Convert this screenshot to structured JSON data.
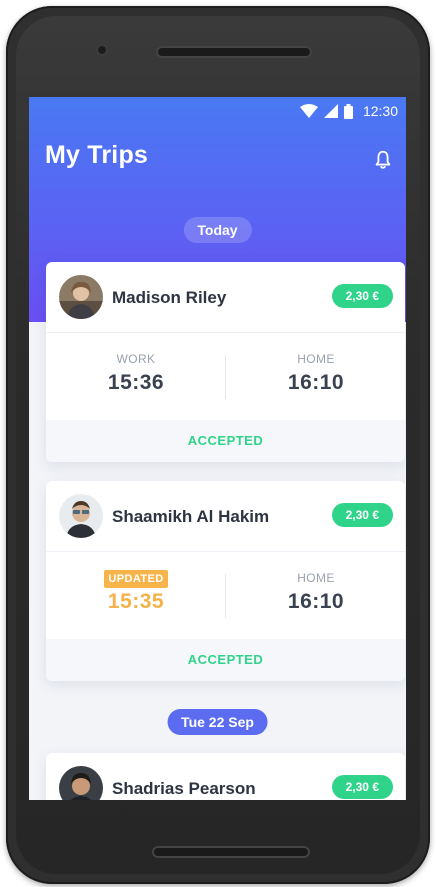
{
  "status_bar": {
    "time": "12:30"
  },
  "header": {
    "title": "My Trips"
  },
  "sections": [
    {
      "label": "Today"
    },
    {
      "label": "Tue 22 Sep"
    }
  ],
  "trips": [
    {
      "name": "Madison Riley",
      "price": "2,30 €",
      "from_label": "WORK",
      "from_time": "15:36",
      "to_label": "HOME",
      "to_time": "16:10",
      "status": "ACCEPTED"
    },
    {
      "name": "Shaamikh Al Hakim",
      "price": "2,30 €",
      "from_label": "UPDATED",
      "from_time": "15:35",
      "to_label": "HOME",
      "to_time": "16:10",
      "status": "ACCEPTED"
    },
    {
      "name": "Shadrias Pearson",
      "price": "2,30 €"
    }
  ],
  "colors": {
    "accent_green": "#2fd48a",
    "updated_orange": "#f4b24a",
    "header_gradient_top": "#4a79f3",
    "header_gradient_bottom": "#6a4ff2"
  },
  "icons": [
    "wifi-icon",
    "signal-icon",
    "battery-icon",
    "bell-icon"
  ]
}
